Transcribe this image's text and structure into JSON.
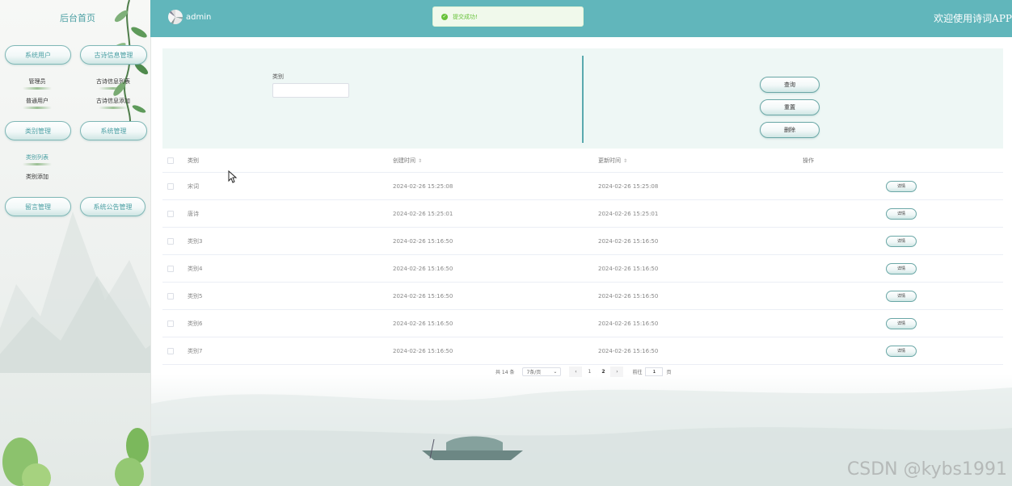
{
  "sidebar": {
    "brand": "后台首页",
    "menus": [
      {
        "label": "系统用户",
        "items": [
          "管理员",
          "普通用户"
        ]
      },
      {
        "label": "古诗信息管理",
        "items": [
          "古诗信息列表",
          "古诗信息添加"
        ]
      },
      {
        "label": "类别管理",
        "items": [
          "类别列表",
          "类别添加"
        ]
      },
      {
        "label": "系统管理",
        "items": []
      },
      {
        "label": "留言管理",
        "items": []
      },
      {
        "label": "系统公告管理",
        "items": []
      }
    ]
  },
  "header": {
    "username": "admin",
    "welcome": "欢迎使用诗词APP",
    "toast": "提交成功!"
  },
  "search": {
    "category_label": "类别",
    "category_value": "",
    "buttons": {
      "query": "查询",
      "reset": "重置",
      "delete": "删除"
    }
  },
  "table": {
    "headers": {
      "category": "类别",
      "created": "创建时间",
      "updated": "更新时间",
      "operation": "操作"
    },
    "rows": [
      {
        "category": "宋词",
        "created": "2024-02-26 15:25:08",
        "updated": "2024-02-26 15:25:08",
        "action": "详情"
      },
      {
        "category": "唐诗",
        "created": "2024-02-26 15:25:01",
        "updated": "2024-02-26 15:25:01",
        "action": "详情"
      },
      {
        "category": "类别3",
        "created": "2024-02-26 15:16:50",
        "updated": "2024-02-26 15:16:50",
        "action": "详情"
      },
      {
        "category": "类别4",
        "created": "2024-02-26 15:16:50",
        "updated": "2024-02-26 15:16:50",
        "action": "详情"
      },
      {
        "category": "类别5",
        "created": "2024-02-26 15:16:50",
        "updated": "2024-02-26 15:16:50",
        "action": "详情"
      },
      {
        "category": "类别6",
        "created": "2024-02-26 15:16:50",
        "updated": "2024-02-26 15:16:50",
        "action": "详情"
      },
      {
        "category": "类别7",
        "created": "2024-02-26 15:16:50",
        "updated": "2024-02-26 15:16:50",
        "action": "详情"
      }
    ]
  },
  "pagination": {
    "total": "共 14 条",
    "page_size": "7条/页",
    "pages": [
      "1",
      "2"
    ],
    "goto_label": "前往",
    "goto_value": "1",
    "page_suffix": "页"
  },
  "watermark": "CSDN @kybs1991",
  "colors": {
    "header": "#61b6bb",
    "accent": "#4a9fa3",
    "panel": "#eef7f5",
    "success": "#67c23a"
  }
}
